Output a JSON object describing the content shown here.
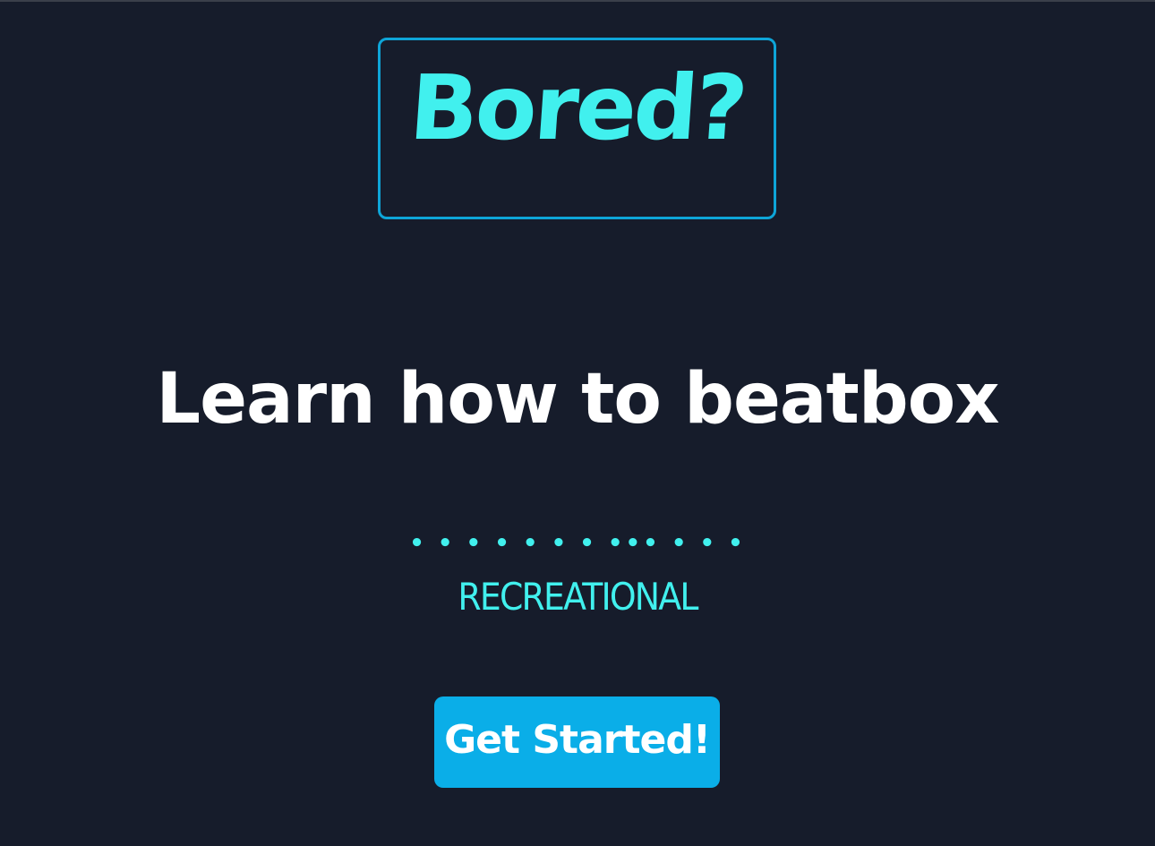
{
  "header": {
    "title": "Bored?"
  },
  "activity": {
    "headline": "Learn how to beatbox",
    "dots": "• • • • • • • ••• • • •",
    "category": "RECREATIONAL"
  },
  "actions": {
    "get_started_label": "Get Started!"
  },
  "colors": {
    "background": "#161c2b",
    "accent": "#41f0ee",
    "border": "#0ea5d8",
    "button": "#0aaee8",
    "text": "#ffffff"
  }
}
